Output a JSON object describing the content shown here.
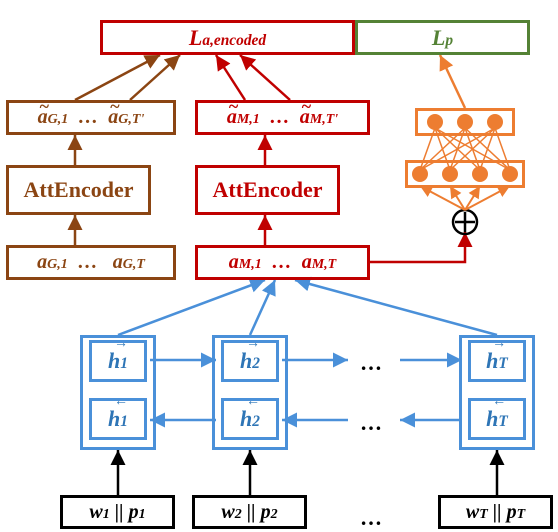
{
  "top": {
    "L_a": "L_a,encoded",
    "L_p": "L_p"
  },
  "tilde_row": {
    "aG1": "ã_G,1",
    "aG_dots": "…",
    "aGT": "ã_G,T'",
    "aM1": "ã_M,1",
    "aM_dots": "…",
    "aMT": "ã_M,T'"
  },
  "encoders": {
    "left": "AttEncoder",
    "right": "AttEncoder"
  },
  "a_row": {
    "aG1": "a_G,1",
    "aG_dots": "…",
    "aGT": "a_G,T",
    "aM1": "a_M,1",
    "aM_dots": "…",
    "aMT": "a_M,T"
  },
  "h": {
    "h1f": "h_1",
    "h1b": "h_1",
    "h2f": "h_2",
    "h2b": "h_2",
    "hTf": "h_T",
    "hTb": "h_T"
  },
  "inputs": {
    "w1": "w_1 || p_1",
    "w2": "w_2 || p_2",
    "wT": "w_T || p_T"
  },
  "dots_mid": "…",
  "chart_data": {
    "type": "diagram",
    "description": "Neural architecture: word/position embeddings (w_i||p_i) feed into a BiLSTM layer with forward h_i and backward h_i states. Outputs form time-step attention features a_M,1..a_M,T which go into AttEncoder (red) producing ã_M,1..ã_M,T' contributing to loss L_a,encoded. A parallel branch a_G,1..a_G,T goes through AttEncoder (brown) producing ã_G,1..ã_G,T' also contributing to L_a,encoded. Pooled (⊕) a_M features also feed a small MLP contributing to loss L_p.",
    "layers": [
      {
        "name": "input",
        "units": [
          "w_1||p_1",
          "w_2||p_2",
          "...",
          "w_T||p_T"
        ]
      },
      {
        "name": "BiLSTM",
        "forward": [
          "h_1",
          "h_2",
          "...",
          "h_T"
        ],
        "backward": [
          "h_1",
          "h_2",
          "...",
          "h_T"
        ]
      },
      {
        "name": "a_M",
        "units": [
          "a_M,1",
          "...",
          "a_M,T"
        ]
      },
      {
        "name": "a_G",
        "units": [
          "a_G,1",
          "...",
          "a_G,T"
        ]
      },
      {
        "name": "AttEncoder_M",
        "outputs": [
          "ã_M,1",
          "...",
          "ã_M,T'"
        ]
      },
      {
        "name": "AttEncoder_G",
        "outputs": [
          "ã_G,1",
          "...",
          "ã_G,T'"
        ]
      },
      {
        "name": "MLP",
        "layers": [
          4,
          3
        ]
      },
      {
        "name": "losses",
        "items": [
          "L_a,encoded",
          "L_p"
        ]
      }
    ]
  }
}
